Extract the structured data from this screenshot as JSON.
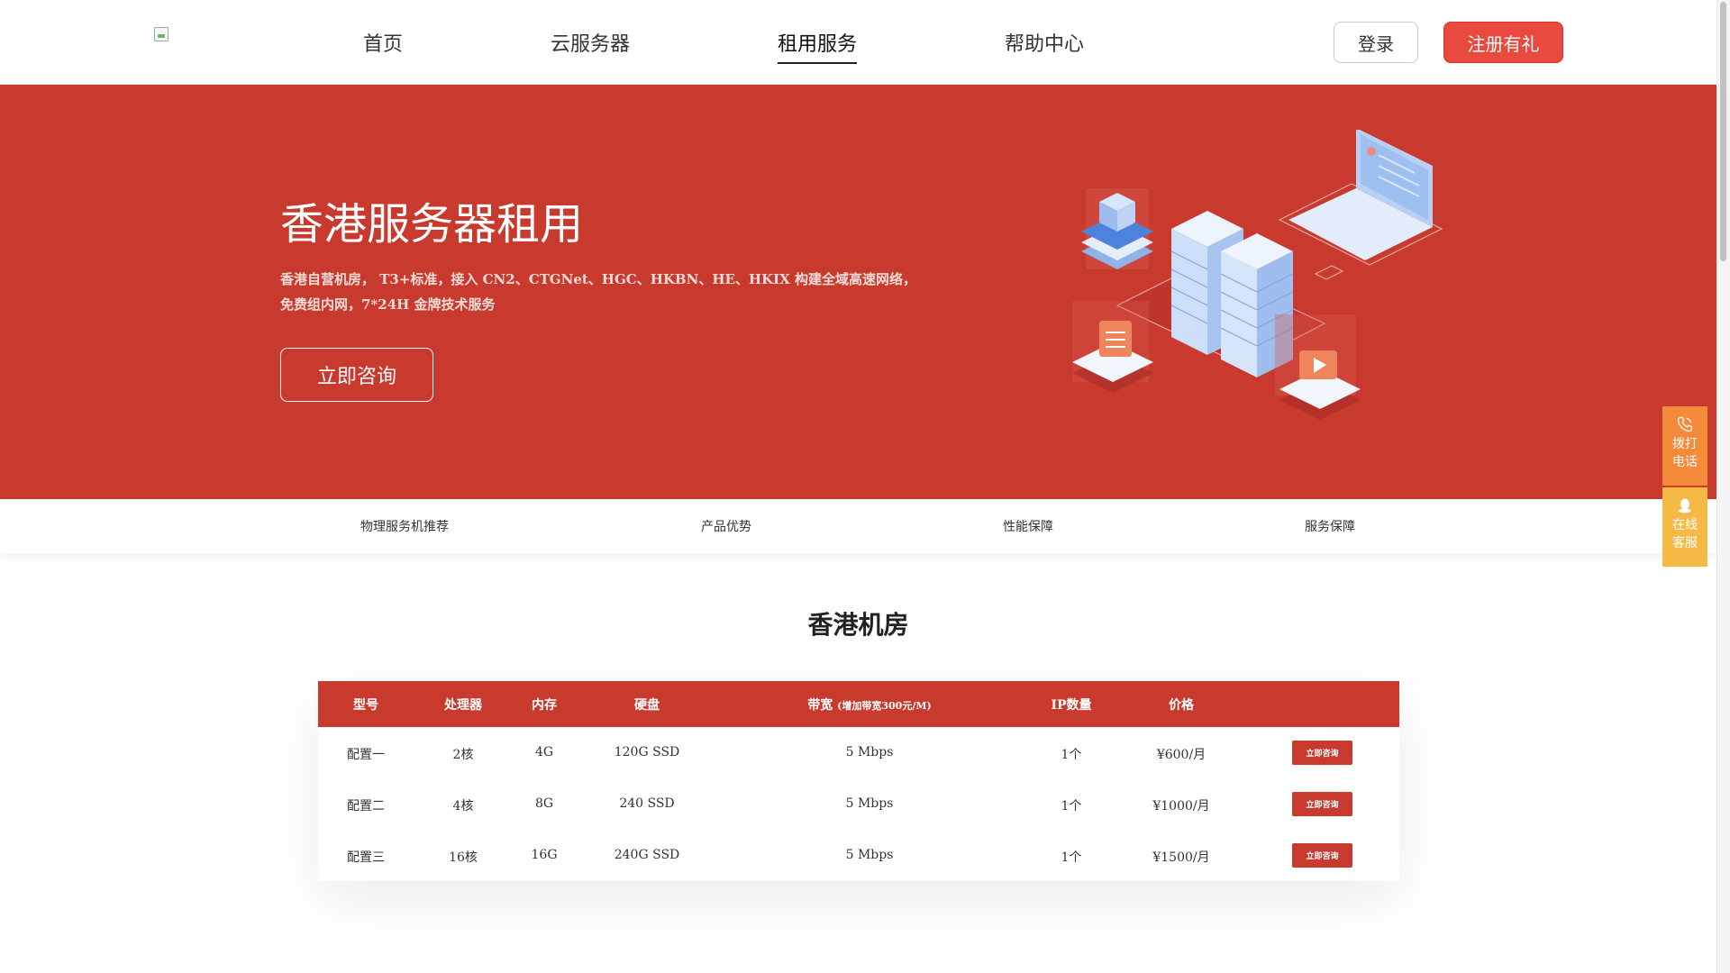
{
  "nav": {
    "items": [
      {
        "label": "首页"
      },
      {
        "label": "云服务器"
      },
      {
        "label": "租用服务",
        "active": true
      },
      {
        "label": "帮助中心"
      }
    ],
    "login_label": "登录",
    "register_label": "注册有礼"
  },
  "hero": {
    "title": "香港服务器租用",
    "description": "香港自营机房， T3+标准，接入 CN2、CTGNet、HGC、HKBN、HE、HKIX 构建全域高速网络，免费组内网，7*24H 金牌技术服务",
    "cta_label": "立即咨询"
  },
  "subnav": {
    "items": [
      "物理服务机推荐",
      "产品优势",
      "性能保障",
      "服务保障"
    ]
  },
  "section": {
    "title": "香港机房"
  },
  "table": {
    "headers": {
      "model": "型号",
      "cpu": "处理器",
      "memory": "内存",
      "disk": "硬盘",
      "bandwidth": "带宽",
      "bandwidth_note": "(增加带宽300元/M)",
      "ip": "IP数量",
      "price": "价格"
    },
    "rows": [
      {
        "model": "配置一",
        "cpu": "2核",
        "memory": "4G",
        "disk": "120G SSD",
        "bandwidth": "5 Mbps",
        "ip": "1个",
        "price": "¥600/月",
        "action": "立即咨询"
      },
      {
        "model": "配置二",
        "cpu": "4核",
        "memory": "8G",
        "disk": "240 SSD",
        "bandwidth": "5 Mbps",
        "ip": "1个",
        "price": "¥1000/月",
        "action": "立即咨询"
      },
      {
        "model": "配置三",
        "cpu": "16核",
        "memory": "16G",
        "disk": "240G SSD",
        "bandwidth": "5 Mbps",
        "ip": "1个",
        "price": "¥1500/月",
        "action": "立即咨询"
      }
    ]
  },
  "side_panel": {
    "phone_line1": "拨打",
    "phone_line2": "电话",
    "chat_line1": "在线",
    "chat_line2": "客服"
  },
  "colors": {
    "brand_red": "#c93a2e",
    "register_red": "#e84a3d",
    "phone_orange": "#f38b3a",
    "chat_yellow": "#f5b946"
  }
}
